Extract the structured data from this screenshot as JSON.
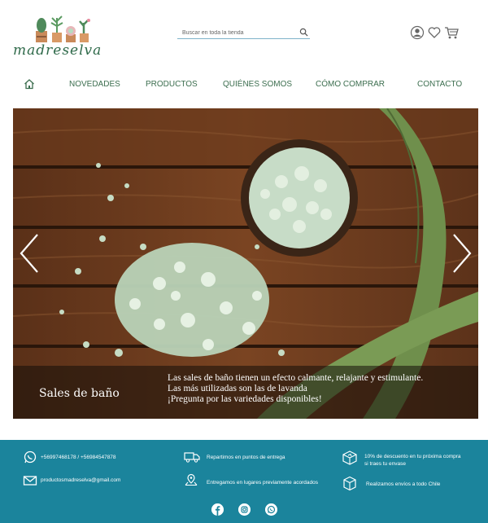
{
  "brand": {
    "logo_text": "madreselva"
  },
  "search": {
    "placeholder": "Buscar en toda la tienda"
  },
  "header_icons": [
    "user-icon",
    "heart-icon",
    "cart-icon"
  ],
  "nav": {
    "items": [
      {
        "label": "NOVEDADES"
      },
      {
        "label": "PRODUCTOS"
      },
      {
        "label": "QUIÉNES SOMOS"
      },
      {
        "label": "CÓMO COMPRAR"
      },
      {
        "label": "CONTACTO"
      }
    ]
  },
  "hero": {
    "title": "Sales de baño",
    "lines": [
      "Las sales de baño tienen un efecto calmante, relajante y estimulante.",
      "Las más utilizadas son las de lavanda",
      "¡Pregunta por las variedades disponibles!"
    ]
  },
  "footer": {
    "phone": "+56997468178 / +56984547878",
    "email": "productosmadreselva@gmail.com",
    "delivery_points": "Repartimos en puntos de entrega",
    "delivery_places": "Entregamos en lugares previamente acordados",
    "discount_line1": "10% de descuento en tu próxima compra",
    "discount_line2": "si traes tu envase",
    "shipping": "Realizamos envíos a todo Chile"
  },
  "colors": {
    "brand_green": "#3c6e4f",
    "footer_teal": "#1b849c",
    "search_underline": "#7fb3c9"
  }
}
